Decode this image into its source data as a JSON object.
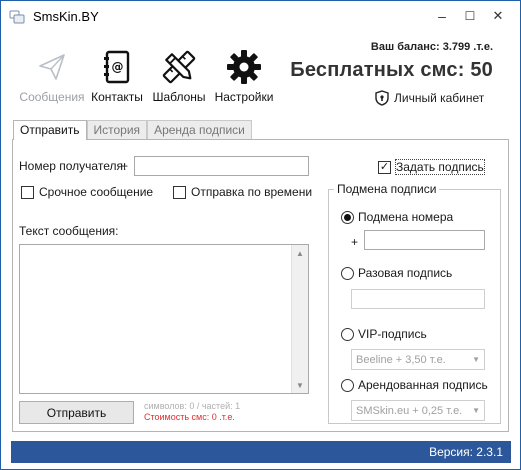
{
  "window": {
    "title": "SmsKin.BY",
    "minimize": "–",
    "maximize": "☐",
    "close": "✕"
  },
  "toolbar": {
    "items": [
      {
        "label": "Сообщения",
        "icon": "paper-plane-icon",
        "enabled": false
      },
      {
        "label": "Контакты",
        "icon": "address-book-icon",
        "enabled": true
      },
      {
        "label": "Шаблоны",
        "icon": "pencil-ruler-icon",
        "enabled": true
      },
      {
        "label": "Настройки",
        "icon": "gear-icon",
        "enabled": true
      }
    ]
  },
  "account": {
    "balance": "Ваш баланс: 3.799 .т.е.",
    "free_sms": "Бесплатных смс: 50",
    "cabinet_label": "Личный кабинет"
  },
  "tabs": [
    {
      "label": "Отправить",
      "active": true
    },
    {
      "label": "История",
      "active": false
    },
    {
      "label": "Аренда подписи",
      "active": false
    }
  ],
  "form": {
    "recipient_label": "Номер получателя:",
    "plus": "+",
    "recipient_value": "",
    "urgent_label": "Срочное сообщение",
    "urgent_checked": false,
    "scheduled_label": "Отправка по времени",
    "scheduled_checked": false,
    "message_label": "Текст сообщения:",
    "message_value": "",
    "send_button": "Отправить",
    "counter_text": "символов: 0 / частей: 1",
    "cost_text": "Стоимость смс: 0 .т.е."
  },
  "signature": {
    "set_label": "Задать подпись",
    "set_checked": true,
    "group_title": "Подмена подписи",
    "options": [
      {
        "label": "Подмена номера",
        "selected": true
      },
      {
        "label": "Разовая подпись",
        "selected": false
      },
      {
        "label": "VIP-подпись",
        "selected": false
      },
      {
        "label": "Арендованная подпись",
        "selected": false
      }
    ],
    "number_plus": "+",
    "number_value": "",
    "one_time_value": "",
    "vip_select": "Beeline + 3,50 т.е.",
    "rented_select": "SMSkin.eu + 0,25 т.е."
  },
  "status": {
    "version": "Версия: 2.3.1"
  },
  "colors": {
    "accent": "#2c579a",
    "cost_red": "#e03030",
    "disabled_grey": "#9aa0a6"
  }
}
